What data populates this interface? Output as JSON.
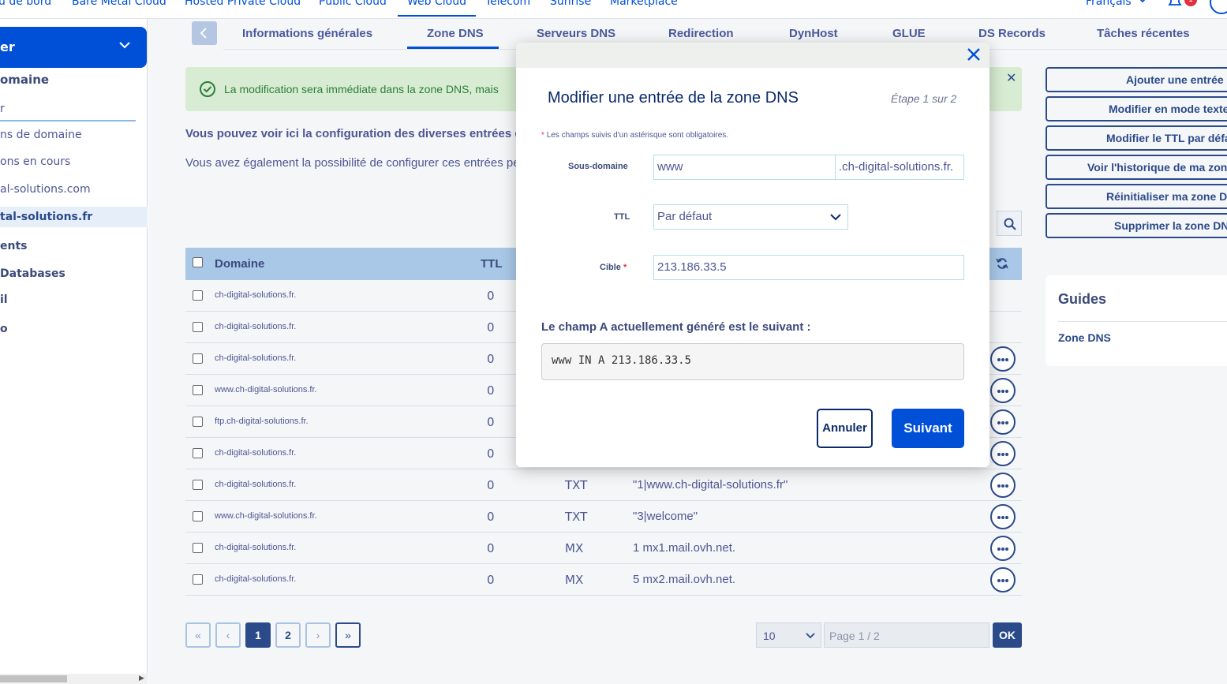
{
  "topnav": {
    "items": [
      "u de bord",
      "Bare Metal Cloud",
      "Hosted Private Cloud",
      "Public Cloud",
      "Web Cloud",
      "Telecom",
      "Sunrise",
      "Marketplace"
    ],
    "language": "Français",
    "notifications": "1"
  },
  "sidebar": {
    "selector": "er",
    "section_title": "omaine",
    "search_placeholder": "r",
    "items": [
      "ns de domaine",
      "ons en cours",
      "al-solutions.com",
      "tal-solutions.fr",
      "ents",
      "Databases",
      "il",
      "o"
    ]
  },
  "tabs": [
    "Informations générales",
    "Zone DNS",
    "Serveurs DNS",
    "Redirection",
    "DynHost",
    "GLUE",
    "DS Records",
    "Tâches récentes"
  ],
  "alert": {
    "message": "La modification sera immédiate dans la zone DNS, mais"
  },
  "intro": {
    "line1": "Vous pouvez voir ici la configuration des diverses entrées d",
    "line2": "Vous avez également la possibilité de configurer ces entrées pe"
  },
  "table": {
    "headers": {
      "domain": "Domaine",
      "ttl": "TTL"
    },
    "rows": [
      {
        "domain": "ch-digital-solutions.fr.",
        "ttl": "0",
        "type": "",
        "target": ""
      },
      {
        "domain": "ch-digital-solutions.fr.",
        "ttl": "0",
        "type": "",
        "target": ""
      },
      {
        "domain": "ch-digital-solutions.fr.",
        "ttl": "0",
        "type": "",
        "target": ""
      },
      {
        "domain": "www.ch-digital-solutions.fr.",
        "ttl": "0",
        "type": "",
        "target": ""
      },
      {
        "domain": "ftp.ch-digital-solutions.fr.",
        "ttl": "0",
        "type": "",
        "target": ""
      },
      {
        "domain": "ch-digital-solutions.fr.",
        "ttl": "0",
        "type": "",
        "target": ""
      },
      {
        "domain": "ch-digital-solutions.fr.",
        "ttl": "0",
        "type": "TXT",
        "target": "\"1|www.ch-digital-solutions.fr\""
      },
      {
        "domain": "www.ch-digital-solutions.fr.",
        "ttl": "0",
        "type": "TXT",
        "target": "\"3|welcome\""
      },
      {
        "domain": "ch-digital-solutions.fr.",
        "ttl": "0",
        "type": "MX",
        "target": "1 mx1.mail.ovh.net."
      },
      {
        "domain": "ch-digital-solutions.fr.",
        "ttl": "0",
        "type": "MX",
        "target": "5 mx2.mail.ovh.net."
      }
    ]
  },
  "pagination": {
    "first": "«",
    "prev": "‹",
    "pages": [
      "1",
      "2"
    ],
    "next": "›",
    "last": "»",
    "per_page": "10",
    "page_placeholder": "Page 1 / 2",
    "ok": "OK"
  },
  "actions": [
    "Ajouter une entrée",
    "Modifier en mode texte",
    "Modifier le TTL par défaut",
    "Voir l'historique de ma zone",
    "Réinitialiser ma zone DNS",
    "Supprimer la zone DNS"
  ],
  "guides": {
    "title": "Guides",
    "items": [
      "Zone DNS"
    ]
  },
  "modal": {
    "title": "Modifier une entrée de la zone DNS",
    "step": "Étape 1 sur 2",
    "required_note": "Les champs suivis d'un astérisque sont obligatoires.",
    "subdomain_label": "Sous-domaine",
    "subdomain_value": "www",
    "subdomain_suffix": ".ch-digital-solutions.fr.",
    "ttl_label": "TTL",
    "ttl_value": "Par défaut",
    "target_label": "Cible",
    "target_value": "213.186.33.5",
    "generated_label": "Le champ A actuellement généré est le suivant :",
    "generated_value": "www IN A 213.186.33.5",
    "cancel": "Annuler",
    "next": "Suivant"
  },
  "colors": {
    "accent": "#0050d7",
    "navy": "#0b2a6b",
    "success_bg": "#d7ecd2"
  }
}
